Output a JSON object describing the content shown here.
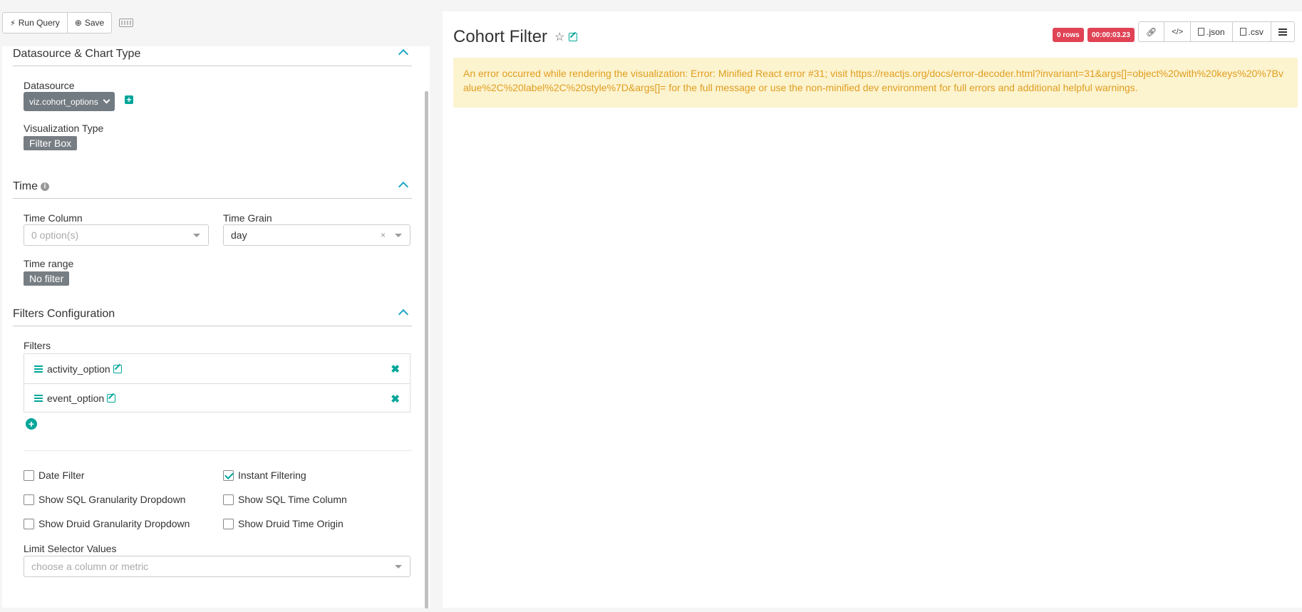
{
  "toolbar": {
    "run_query": "Run Query",
    "save": "Save"
  },
  "left": {
    "datasource_section": "Datasource & Chart Type",
    "datasource_label": "Datasource",
    "datasource_value": "viz.cohort_options",
    "viz_type_label": "Visualization Type",
    "viz_type_value": "Filter Box",
    "time_section": "Time",
    "time_column_label": "Time Column",
    "time_column_placeholder": "0 option(s)",
    "time_grain_label": "Time Grain",
    "time_grain_value": "day",
    "time_range_label": "Time range",
    "time_range_value": "No filter",
    "filters_section": "Filters Configuration",
    "filters_label": "Filters",
    "filters": [
      {
        "name": "activity_option"
      },
      {
        "name": "event_option"
      }
    ],
    "checkboxes": {
      "date_filter": {
        "label": "Date Filter",
        "checked": false
      },
      "instant_filtering": {
        "label": "Instant Filtering",
        "checked": true
      },
      "sql_granularity": {
        "label": "Show SQL Granularity Dropdown",
        "checked": false
      },
      "sql_time_column": {
        "label": "Show SQL Time Column",
        "checked": false
      },
      "druid_granularity": {
        "label": "Show Druid Granularity Dropdown",
        "checked": false
      },
      "druid_time_origin": {
        "label": "Show Druid Time Origin",
        "checked": false
      }
    },
    "limit_label": "Limit Selector Values",
    "limit_placeholder": "choose a column or metric"
  },
  "right": {
    "title": "Cohort Filter",
    "rows_badge": "0 rows",
    "time_badge": "00:00:03.23",
    "json_label": ".json",
    "csv_label": ".csv",
    "error_message": "An error occurred while rendering the visualization: Error: Minified React error #31; visit https://reactjs.org/docs/error-decoder.html?invariant=31&args[]=object%20with%20keys%20%7Bvalue%2C%20label%2C%20style%7D&args[]= for the full message or use the non-minified dev environment for full errors and additional helpful warnings."
  },
  "colors": {
    "accent": "#00a699",
    "badge_red": "#e04355",
    "alert_bg": "#fcf3cf",
    "alert_text": "#e09e1f",
    "tag_gray": "#777e83"
  }
}
